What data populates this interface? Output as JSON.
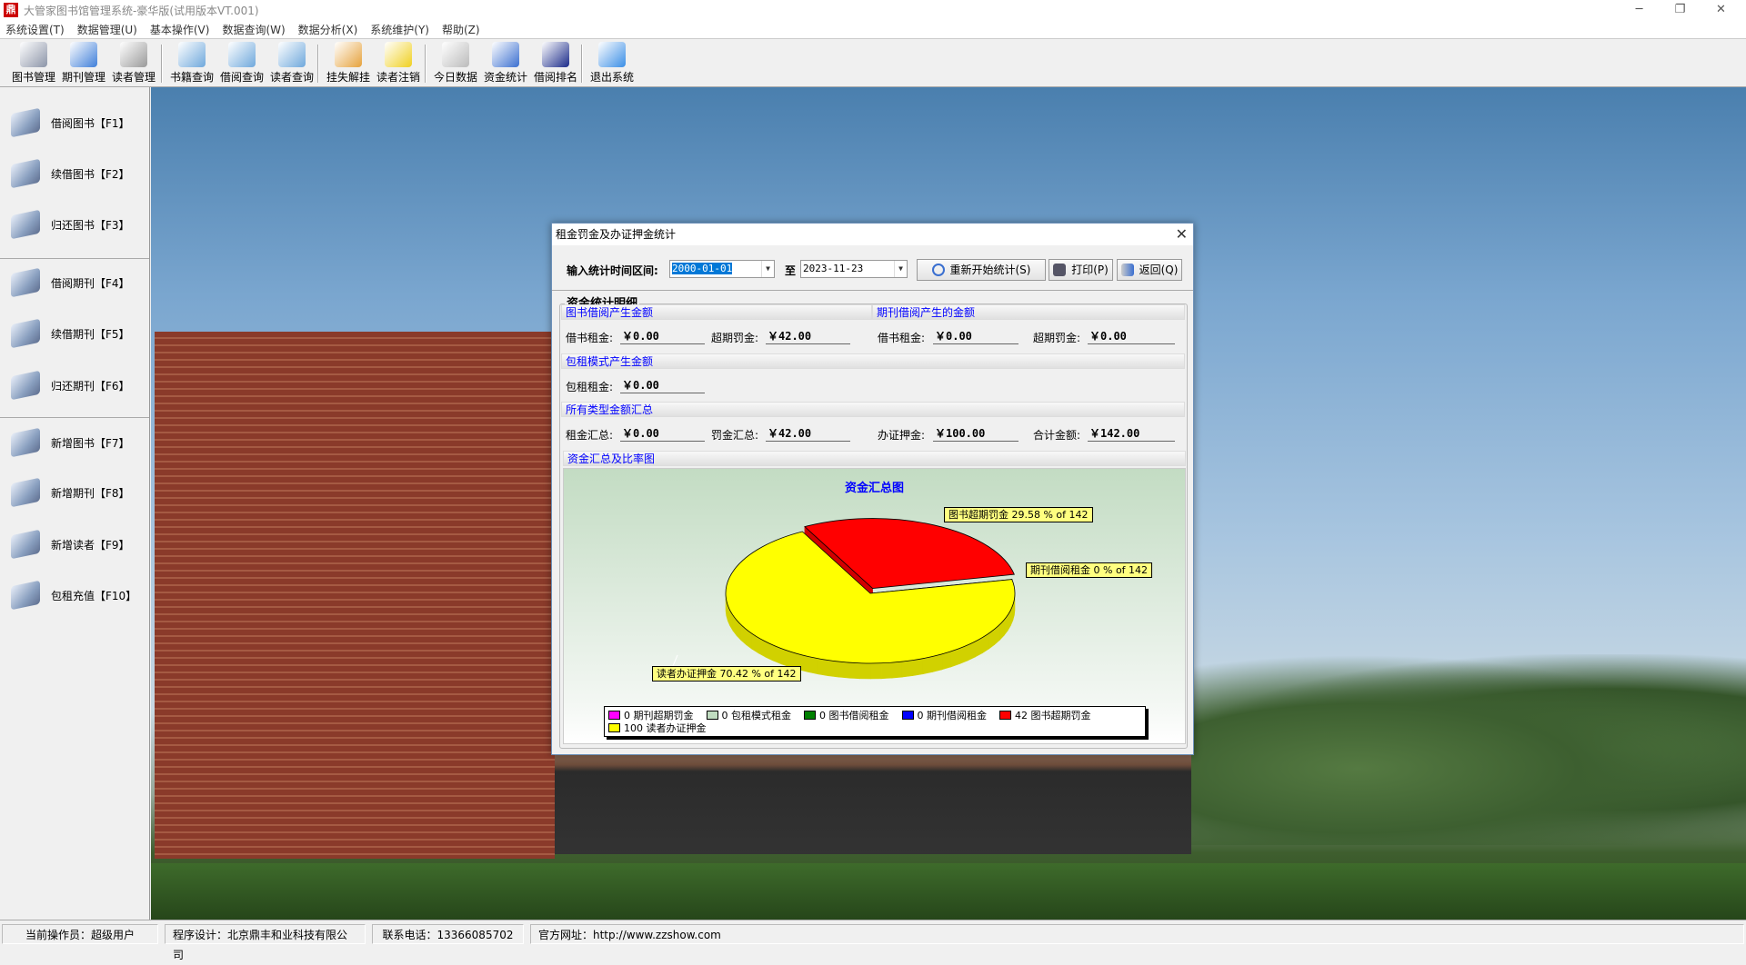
{
  "window": {
    "title": "大管家图书馆管理系统-豪华版(试用版本VT.001)",
    "controls": [
      "minimize",
      "restore",
      "close"
    ]
  },
  "menu": [
    "系统设置(T)",
    "数据管理(U)",
    "基本操作(V)",
    "数据查询(W)",
    "数据分析(X)",
    "系统维护(Y)",
    "帮助(Z)"
  ],
  "toolbar": [
    {
      "label": "图书管理",
      "icon": "book-icon",
      "color": "#8c95a8"
    },
    {
      "label": "期刊管理",
      "icon": "journal-icon",
      "color": "#3f7fd9"
    },
    {
      "label": "读者管理",
      "icon": "readers-icon",
      "color": "#9a9a9a"
    },
    {
      "label": "书籍查询",
      "icon": "folder-search-icon",
      "color": "#6fa8dc"
    },
    {
      "label": "借阅查询",
      "icon": "folder-search-icon",
      "color": "#6fa8dc"
    },
    {
      "label": "读者查询",
      "icon": "folder-search-icon",
      "color": "#6fa8dc"
    },
    {
      "label": "挂失解挂",
      "icon": "folder-lock-icon",
      "color": "#e6a23c"
    },
    {
      "label": "读者注销",
      "icon": "warning-sign-icon",
      "color": "#f0d020"
    },
    {
      "label": "今日数据",
      "icon": "newspaper-icon",
      "color": "#bbbbbb"
    },
    {
      "label": "资金统计",
      "icon": "pie-chart-icon",
      "color": "#3a6fd0"
    },
    {
      "label": "借阅排名",
      "icon": "bar-chart-icon",
      "color": "#1a2a8a"
    },
    {
      "label": "退出系统",
      "icon": "finder-icon",
      "color": "#3a8ee6"
    }
  ],
  "sidebar": [
    {
      "label": "借阅图书【F1】",
      "icon": "borrow-book-icon"
    },
    {
      "label": "续借图书【F2】",
      "icon": "renew-book-icon"
    },
    {
      "label": "归还图书【F3】",
      "icon": "return-book-icon"
    },
    {
      "label": "借阅期刊【F4】",
      "icon": "borrow-journal-icon"
    },
    {
      "label": "续借期刊【F5】",
      "icon": "renew-journal-icon"
    },
    {
      "label": "归还期刊【F6】",
      "icon": "return-journal-icon"
    },
    {
      "label": "新增图书【F7】",
      "icon": "add-book-icon"
    },
    {
      "label": "新增期刊【F8】",
      "icon": "add-journal-icon"
    },
    {
      "label": "新增读者【F9】",
      "icon": "add-reader-icon"
    },
    {
      "label": "包租充值【F10】",
      "icon": "recharge-icon"
    }
  ],
  "statusbar": [
    "当前操作员：超级用户",
    "程序设计：北京鼎丰和业科技有限公司",
    "联系电话：13366085702",
    "官方网址：http://www.zzshow.com"
  ],
  "dialog": {
    "title": "租金罚金及办证押金统计",
    "range_label": "输入统计时间区间:",
    "start_date": "2000-01-01",
    "to_label": "至",
    "end_date": "2023-11-23",
    "restart_button": "重新开始统计(S)",
    "print_button": "打印(P)",
    "return_button": "返回(Q)",
    "group_title": "资金统计明细",
    "sections": {
      "book": "图书借阅产生金额",
      "journal": "期刊借阅产生的金额",
      "rental": "包租模式产生金额",
      "total": "所有类型金额汇总",
      "chart": "资金汇总及比率图"
    },
    "fields": {
      "book_rent": {
        "label": "借书租金:",
        "value": "￥0.00"
      },
      "book_fine": {
        "label": "超期罚金:",
        "value": "￥42.00"
      },
      "journal_rent": {
        "label": "借书租金:",
        "value": "￥0.00"
      },
      "journal_fine": {
        "label": "超期罚金:",
        "value": "￥0.00"
      },
      "rental_rent": {
        "label": "包租租金:",
        "value": "￥0.00"
      },
      "rent_total": {
        "label": "租金汇总:",
        "value": "￥0.00"
      },
      "fine_total": {
        "label": "罚金汇总:",
        "value": "￥42.00"
      },
      "deposit": {
        "label": "办证押金:",
        "value": "￥100.00"
      },
      "grand_total": {
        "label": "合计金额:",
        "value": "￥142.00"
      }
    }
  },
  "chart_data": {
    "type": "pie",
    "title": "资金汇总图",
    "total": 142,
    "slices": [
      {
        "name": "图书超期罚金",
        "value": 42,
        "percent": 29.58,
        "color": "#ff0000",
        "label": "图书超期罚金 29.58 % of 142",
        "legend": "42 图书超期罚金"
      },
      {
        "name": "期刊借阅租金",
        "value": 0,
        "percent": 0,
        "color": "#0000ff",
        "label": "期刊借阅租金 0 % of 142",
        "legend": "0 期刊借阅租金"
      },
      {
        "name": "读者办证押金",
        "value": 100,
        "percent": 70.42,
        "color": "#ffff00",
        "label": "读者办证押金 70.42 % of 142",
        "legend": "100 读者办证押金"
      }
    ],
    "legend": [
      {
        "text": "0 期刊超期罚金",
        "color": "#ff00ff"
      },
      {
        "text": "0 包租模式租金",
        "color": "#c0dcc0"
      },
      {
        "text": "0 图书借阅租金",
        "color": "#008000"
      },
      {
        "text": "0 期刊借阅租金",
        "color": "#0000ff"
      },
      {
        "text": "42 图书超期罚金",
        "color": "#ff0000"
      },
      {
        "text": "100 读者办证押金",
        "color": "#ffff00"
      }
    ],
    "legend_position": "bottom"
  }
}
